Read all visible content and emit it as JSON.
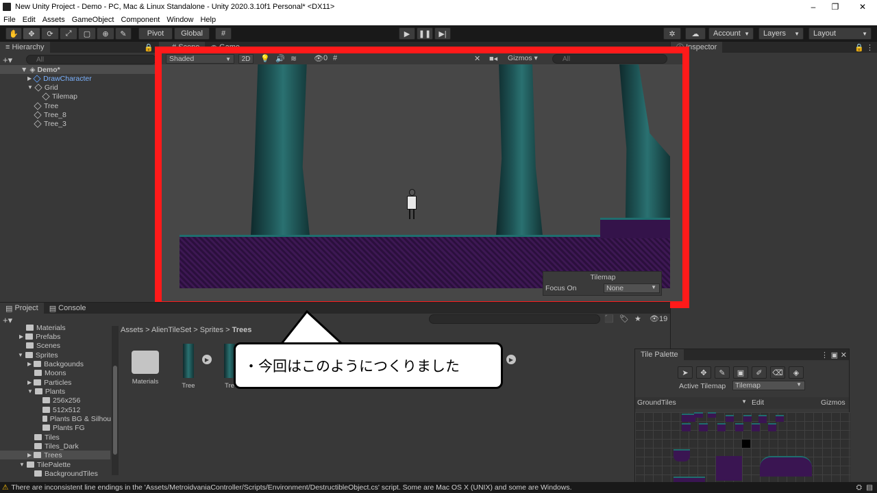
{
  "window": {
    "title": "New Unity Project - Demo - PC, Mac & Linux Standalone - Unity 2020.3.10f1 Personal* <DX11>",
    "minimize": "–",
    "maximize": "❐",
    "close": "✕"
  },
  "menu": [
    "File",
    "Edit",
    "Assets",
    "GameObject",
    "Component",
    "Window",
    "Help"
  ],
  "toolbar": {
    "pivot": "Pivot",
    "global": "Global",
    "account": "Account",
    "layers": "Layers",
    "layout": "Layout"
  },
  "hierarchy": {
    "tab": "Hierarchy",
    "search_placeholder": "All",
    "scene": "Demo*",
    "items": [
      {
        "label": "DrawCharacter",
        "highlight": true
      },
      {
        "label": "Grid"
      },
      {
        "label": "Tilemap"
      },
      {
        "label": "Tree"
      },
      {
        "label": "Tree_8"
      },
      {
        "label": "Tree_3"
      }
    ]
  },
  "scene": {
    "tab_scene": "Scene",
    "tab_game": "Game",
    "shading": "Shaded",
    "mode_2d": "2D",
    "hidden_count": "0",
    "gizmos": "Gizmos",
    "search_placeholder": "All",
    "overlay_title": "Tilemap",
    "focus_label": "Focus On",
    "focus_value": "None"
  },
  "inspector": {
    "tab": "Inspector"
  },
  "project": {
    "tab_project": "Project",
    "tab_console": "Console",
    "hidden_count": "19",
    "tree": [
      {
        "label": "Materials",
        "indent": 1
      },
      {
        "label": "Prefabs",
        "indent": 1
      },
      {
        "label": "Scenes",
        "indent": 1
      },
      {
        "label": "Sprites",
        "indent": 1
      },
      {
        "label": "Backgounds",
        "indent": 2
      },
      {
        "label": "Moons",
        "indent": 2
      },
      {
        "label": "Particles",
        "indent": 2
      },
      {
        "label": "Plants",
        "indent": 2
      },
      {
        "label": "256x256",
        "indent": 3
      },
      {
        "label": "512x512",
        "indent": 3
      },
      {
        "label": "Plants BG & Silhou",
        "indent": 3
      },
      {
        "label": "Plants FG",
        "indent": 3
      },
      {
        "label": "Tiles",
        "indent": 2
      },
      {
        "label": "Tiles_Dark",
        "indent": 2
      },
      {
        "label": "Trees",
        "indent": 2,
        "selected": true
      },
      {
        "label": "TilePalette",
        "indent": 1
      },
      {
        "label": "BackgroundTiles",
        "indent": 2
      }
    ],
    "breadcrumb": [
      "Assets",
      "AlienTileSet",
      "Sprites",
      "Trees"
    ],
    "assets": [
      "Materials",
      "Tree",
      "Tre"
    ]
  },
  "callout": "・今回はこのようにつくりました",
  "palette": {
    "title": "Tile Palette",
    "active_label": "Active Tilemap",
    "active_value": "Tilemap",
    "palette_name": "GroundTiles",
    "edit": "Edit",
    "gizmos": "Gizmos"
  },
  "status": "There are inconsistent line endings in the 'Assets/MetroidvaniaController/Scripts/Environment/DestructibleObject.cs' script. Some are Mac OS X (UNIX) and some are Windows."
}
